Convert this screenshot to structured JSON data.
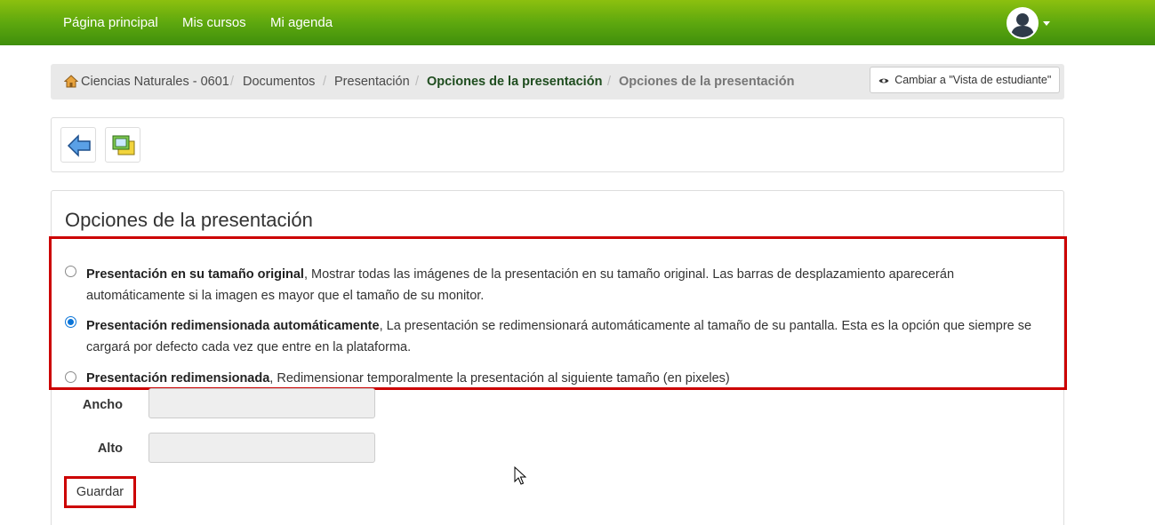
{
  "navbar": {
    "links": [
      "Página principal",
      "Mis cursos",
      "Mi agenda"
    ],
    "avatar_icon": "user-avatar-icon"
  },
  "breadcrumb": {
    "course": "Ciencias Naturales - 0601",
    "documents": "Documentos",
    "presentation": "Presentación",
    "options": "Opciones de la presentación",
    "current": "Opciones de la presentación",
    "separator": "/",
    "student_view_button": "Cambiar a \"Vista de estudiante\""
  },
  "panel": {
    "title": "Opciones de la presentación",
    "options": [
      {
        "label": "Presentación en su tamaño original",
        "description": ", Mostrar todas las imágenes de la presentación en su tamaño original. Las barras de desplazamiento aparecerán automáticamente si la imagen es mayor que el tamaño de su monitor.",
        "checked": false
      },
      {
        "label": "Presentación redimensionada automáticamente",
        "description": ", La presentación se redimensionará automáticamente al tamaño de su pantalla. Esta es la opción que siempre se cargará por defecto cada vez que entre en la plataforma.",
        "checked": true
      },
      {
        "label": "Presentación redimensionada",
        "description": ", Redimensionar temporalmente la presentación al siguiente tamaño (en pixeles)",
        "checked": false
      }
    ],
    "width_label": "Ancho",
    "height_label": "Alto",
    "width_value": "",
    "height_value": "",
    "save_button": "Guardar"
  },
  "colors": {
    "nav_green": "#5ea80e",
    "highlight_red": "#cc0000",
    "radio_blue": "#0a74d8"
  }
}
